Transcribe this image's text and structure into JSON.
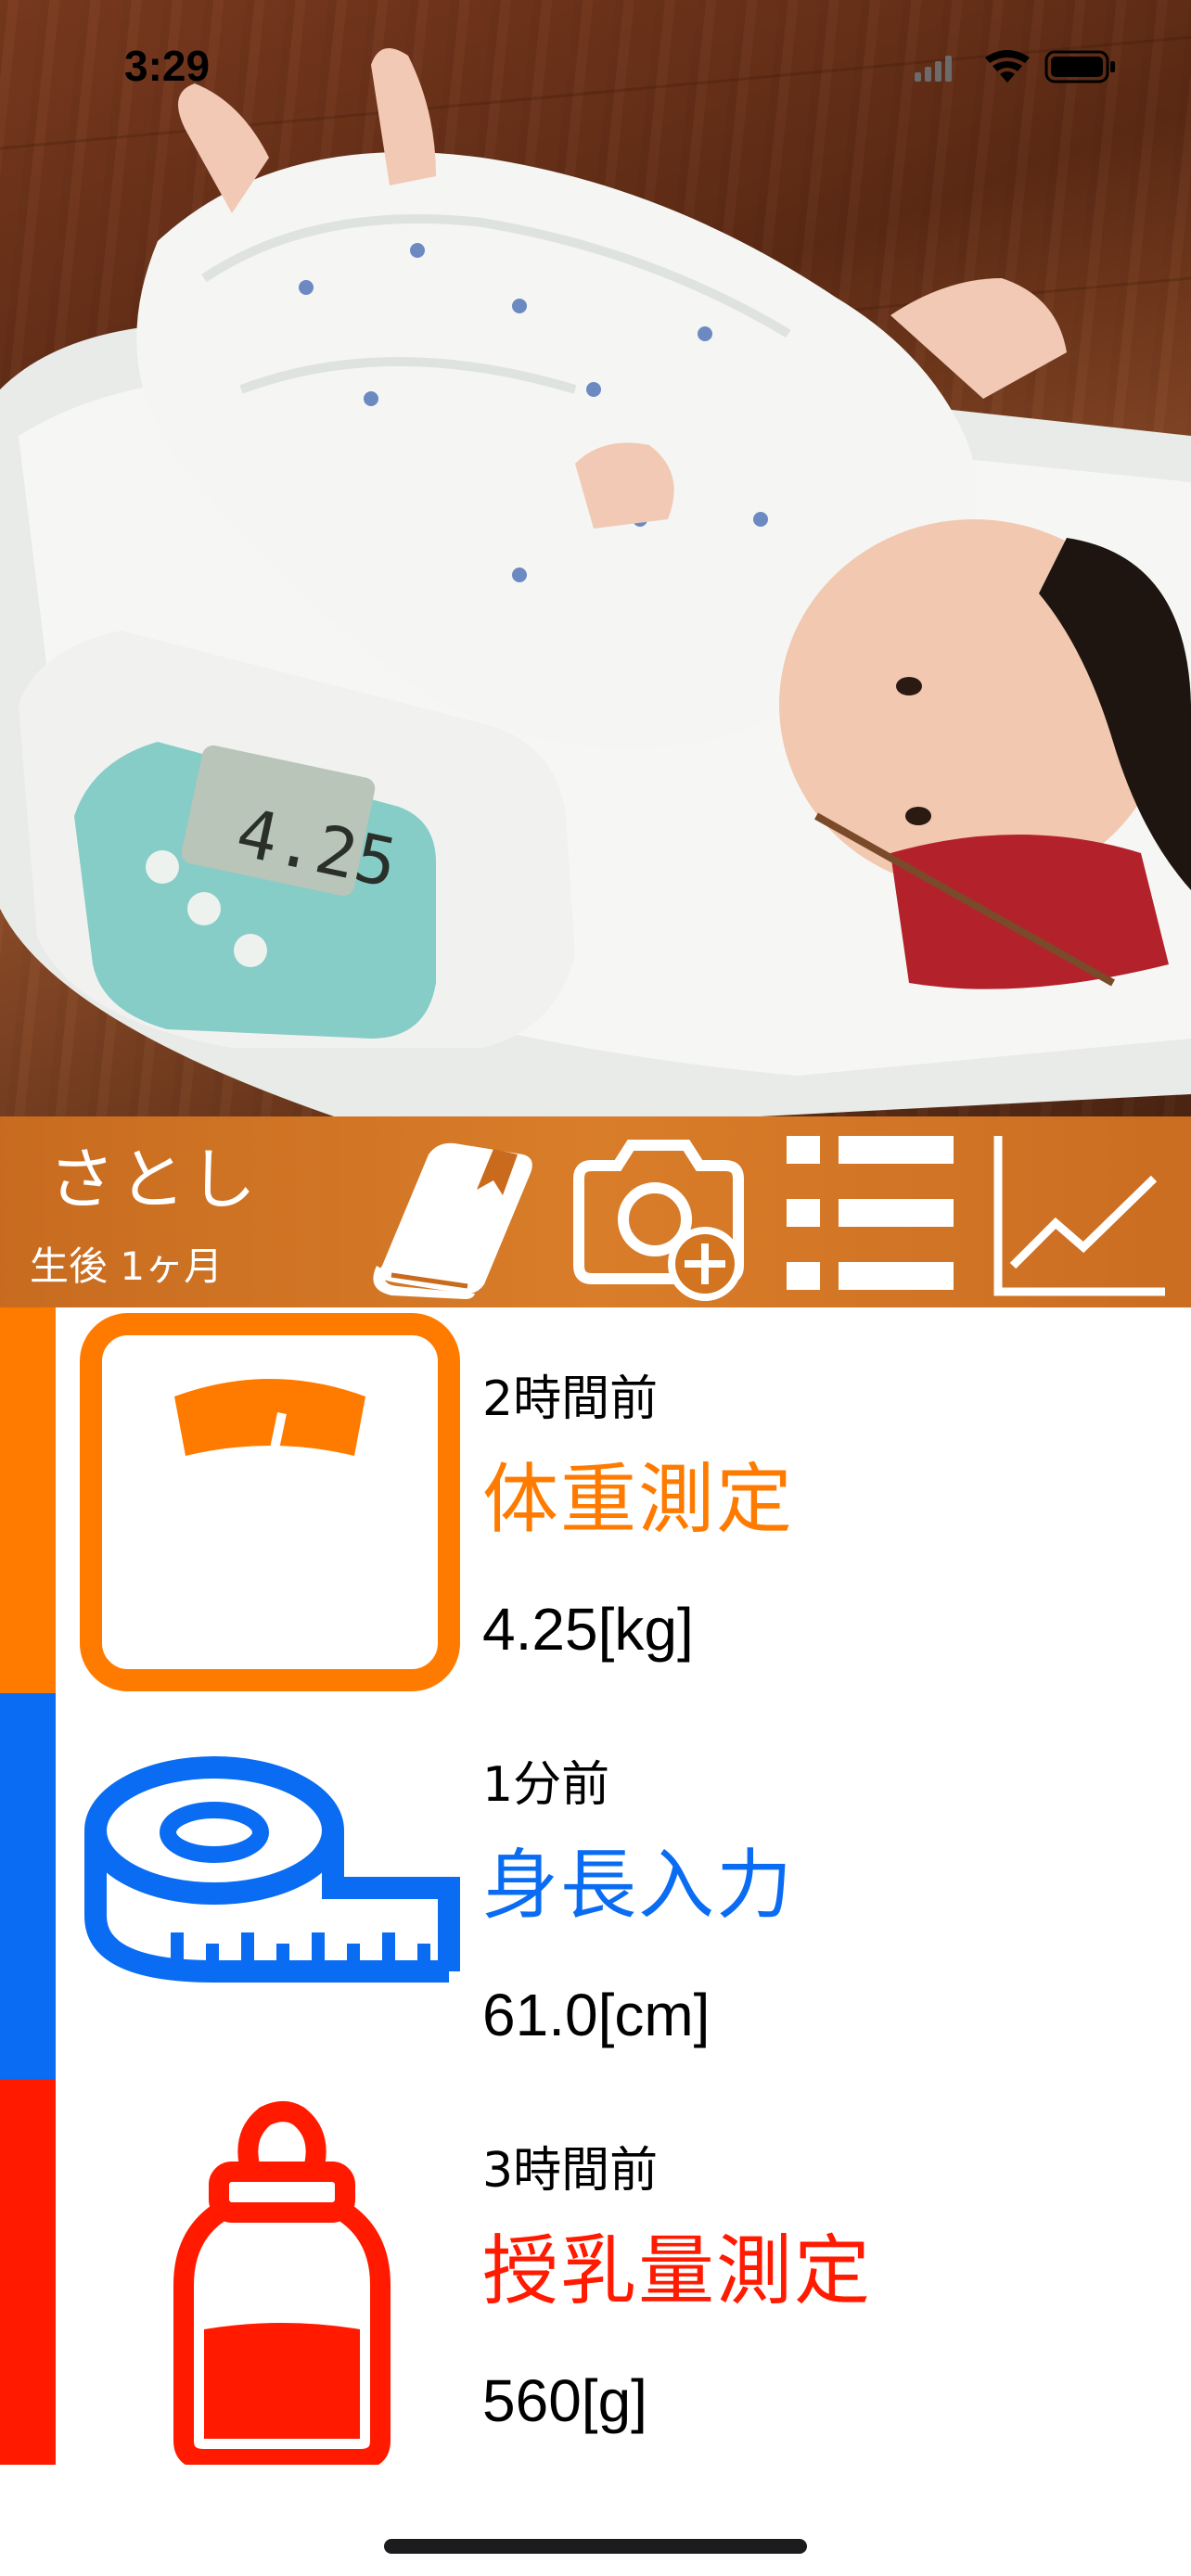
{
  "status_bar": {
    "time": "3:29",
    "icons": [
      "cellular-icon",
      "wifi-icon",
      "battery-icon"
    ]
  },
  "hero": {
    "photo": "baby-on-scale-photo",
    "scale_display_reading": "4.25"
  },
  "header": {
    "child_name": "さとし",
    "child_age": "生後 1ヶ月",
    "buttons": [
      {
        "name": "diary",
        "icon": "book-icon"
      },
      {
        "name": "add-photo",
        "icon": "camera-add-icon"
      },
      {
        "name": "list",
        "icon": "list-icon"
      },
      {
        "name": "graph",
        "icon": "line-chart-icon"
      }
    ]
  },
  "records": [
    {
      "time": "2時間前",
      "title": "体重測定",
      "value": "4.25[kg]",
      "color": "#ff7b00",
      "icon": "scale-icon"
    },
    {
      "time": "1分前",
      "title": "身長入力",
      "value": "61.0[cm]",
      "color": "#0a6cf2",
      "icon": "measuring-tape-icon"
    },
    {
      "time": "3時間前",
      "title": "授乳量測定",
      "value": "560[g]",
      "color": "#ff1a00",
      "icon": "baby-bottle-icon"
    }
  ],
  "colors": {
    "header_orange": "#d27420",
    "weight": "#ff7b00",
    "height": "#0a6cf2",
    "feeding": "#ff1a00"
  }
}
